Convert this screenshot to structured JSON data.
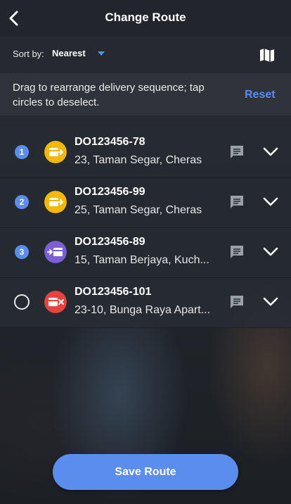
{
  "header": {
    "title": "Change Route",
    "back_icon": "chevron-left-icon"
  },
  "sort": {
    "label": "Sort by:",
    "value": "Nearest",
    "caret_icon": "caret-down-icon",
    "map_icon": "map-icon"
  },
  "instructions": {
    "text": "Drag to rearrange delivery sequence; tap circles to deselect.",
    "reset_label": "Reset"
  },
  "colors": {
    "accent": "#5b8def",
    "pickup": "#f5b800",
    "dropoff": "#7a5fd6",
    "failed": "#e8443f"
  },
  "deliveries": [
    {
      "seq": "1",
      "selected": true,
      "type_icon": "pickup-icon",
      "type_color": "#f5b800",
      "do": "DO123456-78",
      "address": "23, Taman Segar, Cheras"
    },
    {
      "seq": "2",
      "selected": true,
      "type_icon": "pickup-icon",
      "type_color": "#f5b800",
      "do": "DO123456-99",
      "address": "25, Taman Segar, Cheras"
    },
    {
      "seq": "3",
      "selected": true,
      "type_icon": "dropoff-icon",
      "type_color": "#7a5fd6",
      "do": "DO123456-89",
      "address": "15, Taman Berjaya, Kuch..."
    },
    {
      "seq": "",
      "selected": false,
      "type_icon": "cancelled-icon",
      "type_color": "#e8443f",
      "do": "DO123456-101",
      "address": "23-10, Bunga Raya Apart..."
    }
  ],
  "footer": {
    "save_label": "Save Route"
  }
}
